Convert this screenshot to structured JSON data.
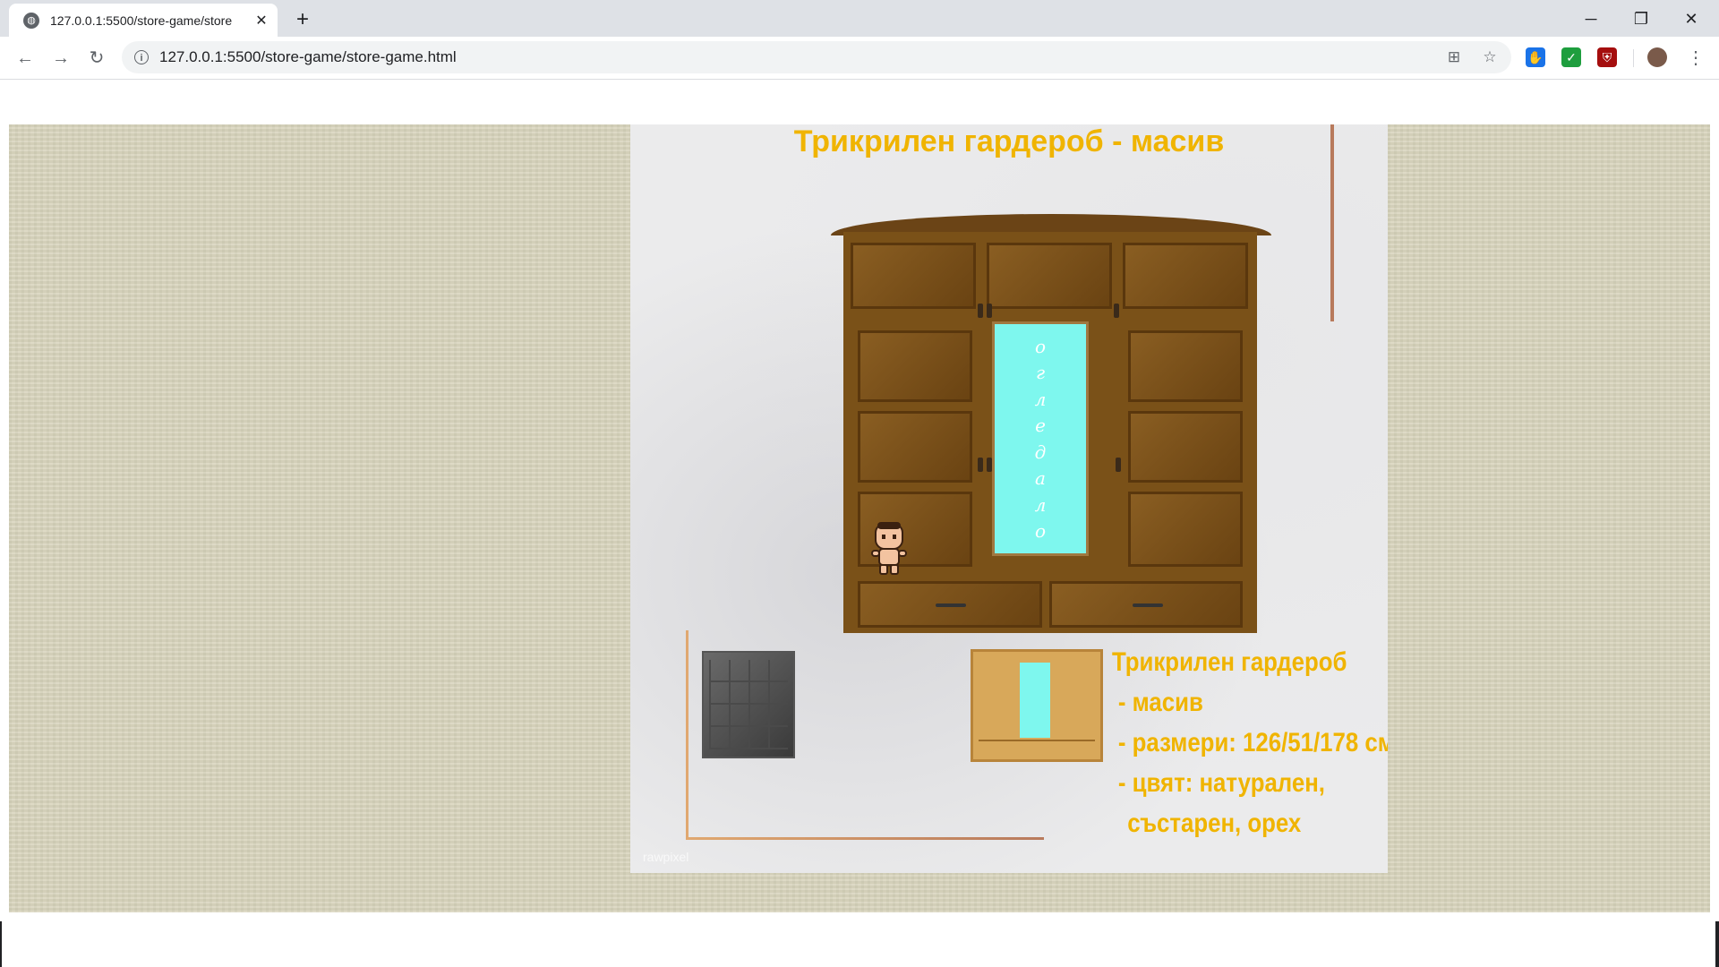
{
  "browser": {
    "tab_title": "127.0.0.1:5500/store-game/store",
    "tab_close": "✕",
    "new_tab": "+",
    "url": "127.0.0.1:5500/store-game/store-game.html",
    "icons": [
      "back-icon",
      "forward-icon",
      "reload-icon",
      "info-icon",
      "translate-icon",
      "star-icon",
      "extension-icon",
      "check-icon",
      "ublock-icon",
      "profile-icon",
      "menu-icon"
    ],
    "window_controls": {
      "minimize": "─",
      "restore": "❐",
      "close": "✕"
    },
    "nav": {
      "back": "←",
      "forward": "→",
      "reload": "↻",
      "info": "i"
    },
    "omni": {
      "translate": "⊞",
      "star": "☆"
    },
    "ext": {
      "hand": "✋",
      "check": "✓",
      "shield": "⛨",
      "menu": "⋮"
    }
  },
  "store": {
    "title": "Трикрилен гардероб - масив",
    "mirror_letters": [
      "о",
      "г",
      "л",
      "е",
      "д",
      "а",
      "л",
      "о"
    ],
    "description": [
      "Трикрилен гардероб",
      "- масив",
      "- размери: 126/51/178 см.",
      "- цвят: натурален,",
      "състарен, орех"
    ],
    "watermark": "rawpixel"
  },
  "colors": {
    "title": "#f0b400",
    "mirror": "#7ef7ee",
    "wood": "#7a5118",
    "background": "#d8d4bc"
  }
}
